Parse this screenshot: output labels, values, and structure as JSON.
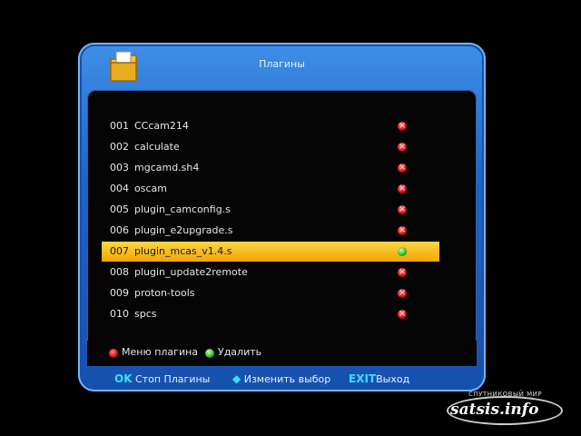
{
  "window": {
    "title": "Плагины"
  },
  "list": {
    "items": [
      {
        "num": "001",
        "name": "CCcam214",
        "status": "red"
      },
      {
        "num": "002",
        "name": "calculate",
        "status": "red"
      },
      {
        "num": "003",
        "name": "mgcamd.sh4",
        "status": "red"
      },
      {
        "num": "004",
        "name": "oscam",
        "status": "red"
      },
      {
        "num": "005",
        "name": "plugin_camconfig.s",
        "status": "red"
      },
      {
        "num": "006",
        "name": "plugin_e2upgrade.s",
        "status": "red"
      },
      {
        "num": "007",
        "name": "plugin_mcas_v1.4.s",
        "status": "green",
        "selected": true
      },
      {
        "num": "008",
        "name": "plugin_update2remote",
        "status": "red"
      },
      {
        "num": "009",
        "name": "proton-tools",
        "status": "red"
      },
      {
        "num": "010",
        "name": "spcs",
        "status": "red"
      }
    ]
  },
  "legend": {
    "red_label": "Меню плагина",
    "green_label": "Удалить"
  },
  "footer": {
    "ok_key": "OK",
    "ok_label": "Стоп Плагины",
    "nav_key": "◆",
    "nav_label": "Изменить выбор",
    "exit_key": "EXIT",
    "exit_label": "Выход"
  },
  "watermark": {
    "top": "СПУТНИКОВЫЙ МИР",
    "main": "satsis.info"
  },
  "colors": {
    "frame_blue": "#1f63c8",
    "selected_yellow": "#f1a600",
    "red_mark": "#e01010",
    "green_mark": "#30c020",
    "accent_cyan": "#35e0ff"
  }
}
